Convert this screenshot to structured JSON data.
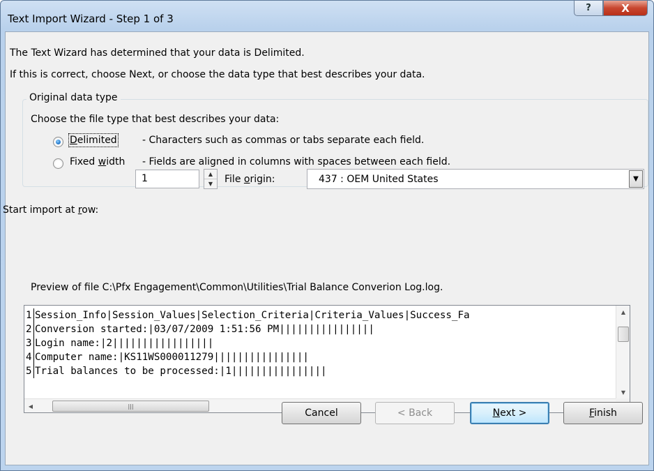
{
  "window": {
    "title": "Text Import Wizard - Step 1 of 3",
    "help_label": "?",
    "close_label": "X"
  },
  "intro": {
    "line1": "The Text Wizard has determined that your data is Delimited.",
    "line2": "If this is correct, choose Next, or choose the data type that best describes your data."
  },
  "original_type": {
    "legend": "Original data type",
    "prompt": "Choose the file type that best describes your data:",
    "options": [
      {
        "label": "Delimited",
        "description": "- Characters such as commas or tabs separate each field.",
        "selected": true
      },
      {
        "label": "Fixed width",
        "description": "- Fields are aligned in columns with spaces between each field.",
        "selected": false
      }
    ]
  },
  "start_row": {
    "label": "Start import at row:",
    "value": "1"
  },
  "file_origin": {
    "label": "File origin:",
    "value": "437 : OEM United States"
  },
  "preview": {
    "label": "Preview of file C:\\Pfx Engagement\\Common\\Utilities\\Trial Balance Converion Log.log.",
    "lines": [
      {
        "num": "1",
        "text": "Session_Info|Session_Values|Selection_Criteria|Criteria_Values|Success_Fa"
      },
      {
        "num": "2",
        "text": "Conversion started:|03/07/2009 1:51:56 PM||||||||||||||||"
      },
      {
        "num": "3",
        "text": "Login name:|2|||||||||||||||||"
      },
      {
        "num": "4",
        "text": "Computer name:|KS11WS000011279||||||||||||||||"
      },
      {
        "num": "5",
        "text": "Trial balances to be processed:|1||||||||||||||||"
      }
    ]
  },
  "buttons": {
    "cancel": "Cancel",
    "back": "< Back",
    "next": "Next >",
    "finish": "Finish"
  }
}
